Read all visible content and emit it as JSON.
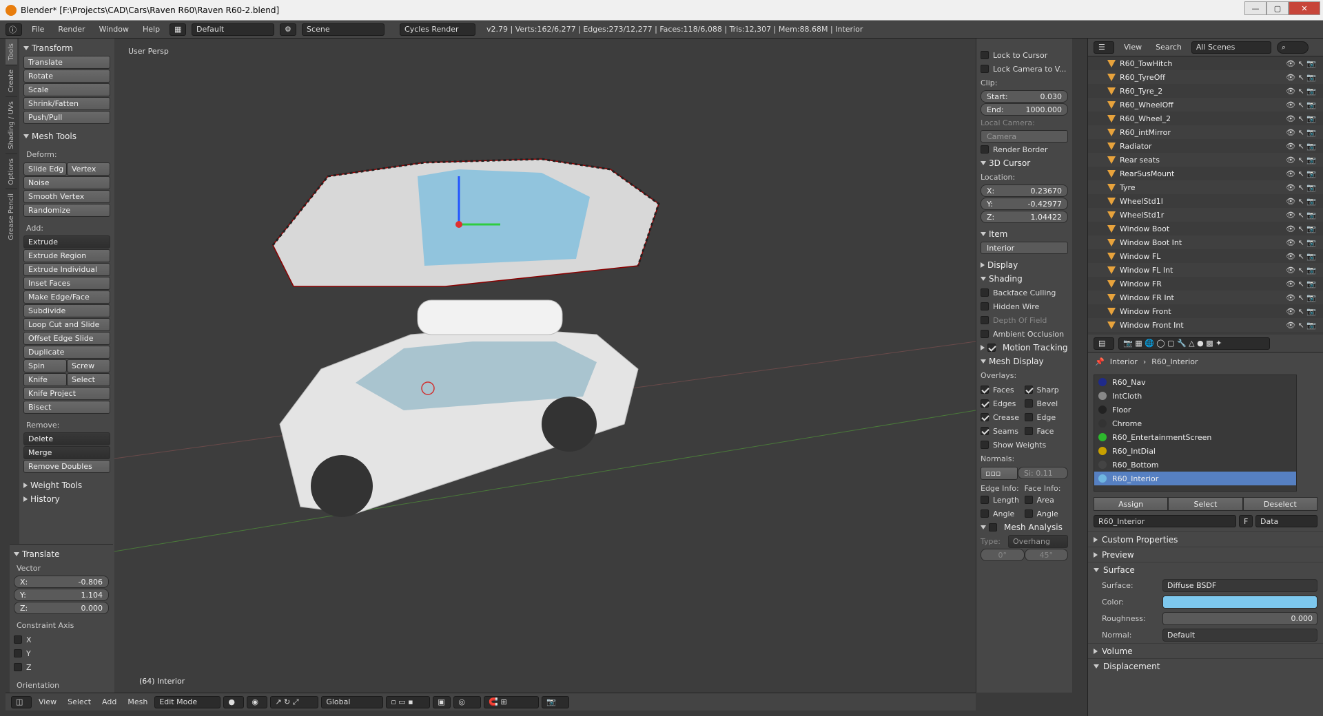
{
  "window": {
    "title": "Blender* [F:\\Projects\\CAD\\Cars\\Raven R60\\Raven R60-2.blend]",
    "min": "—",
    "max": "▢",
    "close": "✕"
  },
  "menu": {
    "file": "File",
    "render": "Render",
    "window": "Window",
    "help": "Help",
    "layout": "Default",
    "scene": "Scene",
    "engine": "Cycles Render",
    "stats": "v2.79 | Verts:162/6,277 | Edges:273/12,277 | Faces:118/6,088 | Tris:12,307 | Mem:88.68M | Interior"
  },
  "tool_tabs": [
    "Tools",
    "Create",
    "Shading / UVs",
    "Options",
    "Grease Pencil"
  ],
  "tools": {
    "transform_title": "Transform",
    "transform": [
      "Translate",
      "Rotate",
      "Scale",
      "Shrink/Fatten",
      "Push/Pull"
    ],
    "mesh_tools_title": "Mesh Tools",
    "deform_label": "Deform:",
    "slide_edge": "Slide Edg",
    "vertex": "Vertex",
    "deform": [
      "Noise",
      "Smooth Vertex",
      "Randomize"
    ],
    "add_label": "Add:",
    "extrude": "Extrude",
    "add": [
      "Extrude Region",
      "Extrude Individual",
      "Inset Faces",
      "Make Edge/Face",
      "Subdivide",
      "Loop Cut and Slide",
      "Offset Edge Slide",
      "Duplicate"
    ],
    "spin": "Spin",
    "screw": "Screw",
    "knife": "Knife",
    "select": "Select",
    "add2": [
      "Knife Project",
      "Bisect"
    ],
    "remove_label": "Remove:",
    "delete": "Delete",
    "merge": "Merge",
    "remove_doubles": "Remove Doubles",
    "weight_tools": "Weight Tools",
    "history": "History"
  },
  "operator": {
    "title": "Translate",
    "vector_label": "Vector",
    "x_label": "X:",
    "x": "-0.806",
    "y_label": "Y:",
    "y": "1.104",
    "z_label": "Z:",
    "z": "0.000",
    "constraint_label": "Constraint Axis",
    "cx": "X",
    "cy": "Y",
    "cz": "Z",
    "orientation_label": "Orientation"
  },
  "viewport": {
    "label": "User Persp",
    "object_label": "(64) Interior"
  },
  "vp_header": {
    "view": "View",
    "select": "Select",
    "add": "Add",
    "mesh": "Mesh",
    "mode": "Edit Mode",
    "orientation": "Global"
  },
  "props_panel": {
    "lock_cursor": "Lock to Cursor",
    "lock_camera": "Lock Camera to V...",
    "clip_label": "Clip:",
    "start_label": "Start:",
    "start": "0.030",
    "end_label": "End:",
    "end": "1000.000",
    "local_camera": "Local Camera:",
    "camera": "Camera",
    "render_border": "Render Border",
    "cursor_title": "3D Cursor",
    "location_label": "Location:",
    "cx_label": "X:",
    "cx": "0.23670",
    "cy_label": "Y:",
    "cy": "-0.42977",
    "cz_label": "Z:",
    "cz": "1.04422",
    "item_title": "Item",
    "item_name": "Interior",
    "display_title": "Display",
    "shading_title": "Shading",
    "backface": "Backface Culling",
    "hidden_wire": "Hidden Wire",
    "dof": "Depth Of Field",
    "ao": "Ambient Occlusion",
    "motion_tracking": "Motion Tracking",
    "mesh_display": "Mesh Display",
    "overlays": "Overlays:",
    "faces": "Faces",
    "sharp": "Sharp",
    "edges": "Edges",
    "bevel": "Bevel",
    "crease": "Crease",
    "edge": "Edge",
    "seams": "Seams",
    "face": "Face",
    "show_weights": "Show Weights",
    "normals": "Normals:",
    "normal_size": "Si: 0.11",
    "edge_info": "Edge Info:",
    "face_info": "Face Info:",
    "length": "Length",
    "area": "Area",
    "angle": "Angle",
    "angle2": "Angle",
    "mesh_analysis": "Mesh Analysis",
    "type_label": "Type:",
    "type": "Overhang",
    "deg0": "0°",
    "deg45": "45°"
  },
  "outliner": {
    "view": "View",
    "search": "Search",
    "scenes": "All Scenes",
    "items": [
      "R60_TowHitch",
      "R60_TyreOff",
      "R60_Tyre_2",
      "R60_WheelOff",
      "R60_Wheel_2",
      "R60_intMirror",
      "Radiator",
      "Rear seats",
      "RearSusMount",
      "Tyre",
      "WheelStd1l",
      "WheelStd1r",
      "Window Boot",
      "Window Boot Int",
      "Window FL",
      "Window FL Int",
      "Window FR",
      "Window FR Int",
      "Window Front",
      "Window Front Int"
    ]
  },
  "material": {
    "crumb_obj": "Interior",
    "crumb_mat": "R60_Interior",
    "slots": [
      {
        "name": "R60_Nav",
        "color": "#1f2a8a"
      },
      {
        "name": "IntCloth",
        "color": "#888888"
      },
      {
        "name": "Floor",
        "color": "#222222"
      },
      {
        "name": "Chrome",
        "color": "#333333"
      },
      {
        "name": "R60_EntertainmentScreen",
        "color": "#2db82d"
      },
      {
        "name": "R60_IntDial",
        "color": "#c8a000"
      },
      {
        "name": "R60_Bottom",
        "color": "#444444"
      },
      {
        "name": "R60_Interior",
        "color": "#6fb6e0"
      }
    ],
    "assign": "Assign",
    "select": "Select",
    "deselect": "Deselect",
    "mat_name": "R60_Interior",
    "fake": "F",
    "link": "Data",
    "custom_props": "Custom Properties",
    "preview": "Preview",
    "surface": "Surface",
    "surface_label": "Surface:",
    "surface_val": "Diffuse BSDF",
    "color_label": "Color:",
    "color_val": "#7dc8ee",
    "roughness_label": "Roughness:",
    "roughness": "0.000",
    "normal_label": "Normal:",
    "normal_val": "Default",
    "volume": "Volume",
    "displacement": "Displacement"
  }
}
